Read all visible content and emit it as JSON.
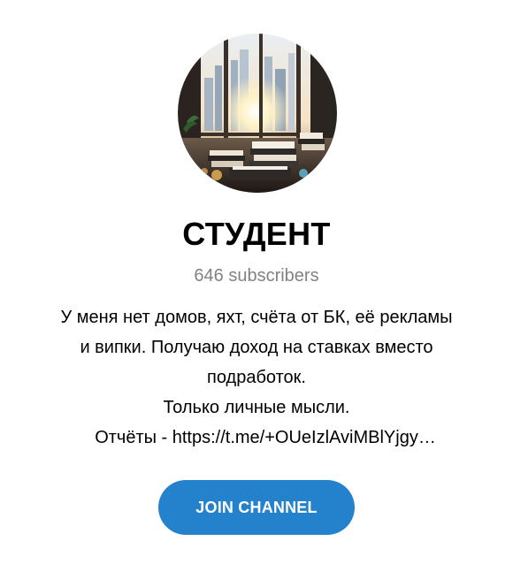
{
  "channel": {
    "avatar_icon": "channel-avatar-image",
    "title": "СТУДЕНТ",
    "subscribers": "646 subscribers",
    "description": {
      "line1": "У меня нет домов, яхт, счёта от БК, её рекламы",
      "line2": "и випки. Получаю доход на ставках вместо",
      "line3": "подработок.",
      "line4": "Только личные мысли.",
      "line5": "Отчёты - https://t.me/+OUeIzlAviMBlYjgy…"
    },
    "join_label": "JOIN CHANNEL"
  },
  "colors": {
    "accent": "#2481cc",
    "muted_text": "#828282",
    "text": "#000000",
    "background": "#ffffff"
  }
}
